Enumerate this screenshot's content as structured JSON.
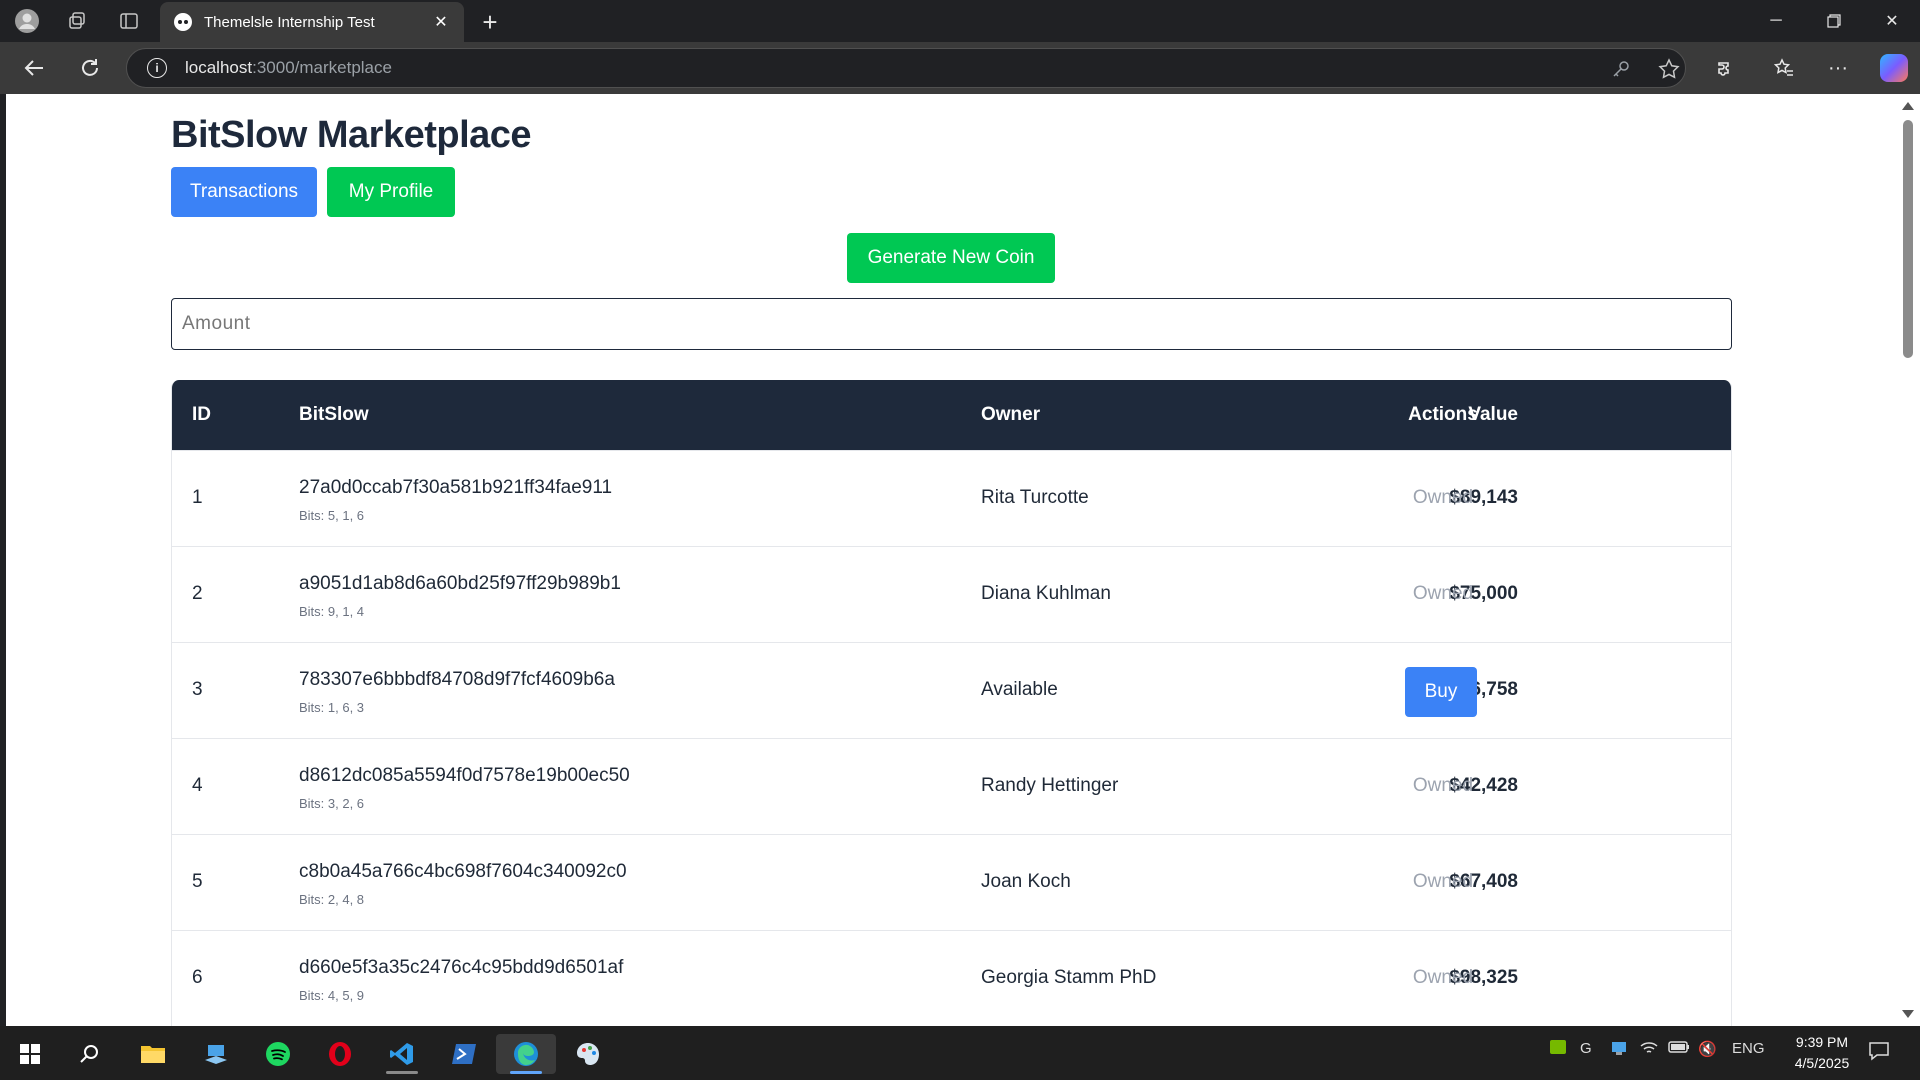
{
  "browser": {
    "tab_title": "Themelsle Internship Test",
    "url_host": "localhost",
    "url_rest": ":3000/marketplace"
  },
  "page": {
    "title": "BitSlow Marketplace",
    "transactions_label": "Transactions",
    "profile_label": "My Profile",
    "generate_label": "Generate New Coin",
    "amount_placeholder": "Amount"
  },
  "table": {
    "headers": {
      "id": "ID",
      "bitslow": "BitSlow",
      "owner": "Owner",
      "value": "Value",
      "actions": "Actions"
    },
    "rows": [
      {
        "id": "1",
        "hash": "27a0d0ccab7f30a581b921ff34fae911",
        "bits": "Bits: 5, 1, 6",
        "owner": "Rita Turcotte",
        "value": "$89,143",
        "action": "Owned"
      },
      {
        "id": "2",
        "hash": "a9051d1ab8d6a60bd25f97ff29b989b1",
        "bits": "Bits: 9, 1, 4",
        "owner": "Diana Kuhlman",
        "value": "$75,000",
        "action": "Owned"
      },
      {
        "id": "3",
        "hash": "783307e6bbbdf84708d9f7fcf4609b6a",
        "bits": "Bits: 1, 6, 3",
        "owner": "Available",
        "value": "$66,758",
        "action": "Buy"
      },
      {
        "id": "4",
        "hash": "d8612dc085a5594f0d7578e19b00ec50",
        "bits": "Bits: 3, 2, 6",
        "owner": "Randy Hettinger",
        "value": "$42,428",
        "action": "Owned"
      },
      {
        "id": "5",
        "hash": "c8b0a45a766c4bc698f7604c340092c0",
        "bits": "Bits: 2, 4, 8",
        "owner": "Joan Koch",
        "value": "$67,408",
        "action": "Owned"
      },
      {
        "id": "6",
        "hash": "d660e5f3a35c2476c4c95bdd9d6501af",
        "bits": "Bits: 4, 5, 9",
        "owner": "Georgia Stamm PhD",
        "value": "$98,325",
        "action": "Owned"
      }
    ]
  },
  "taskbar": {
    "lang": "ENG",
    "time": "9:39 PM",
    "date": "4/5/2025"
  },
  "colors": {
    "header_dark": "#1e293b",
    "primary_blue": "#3b82f6",
    "green": "#00c853"
  }
}
